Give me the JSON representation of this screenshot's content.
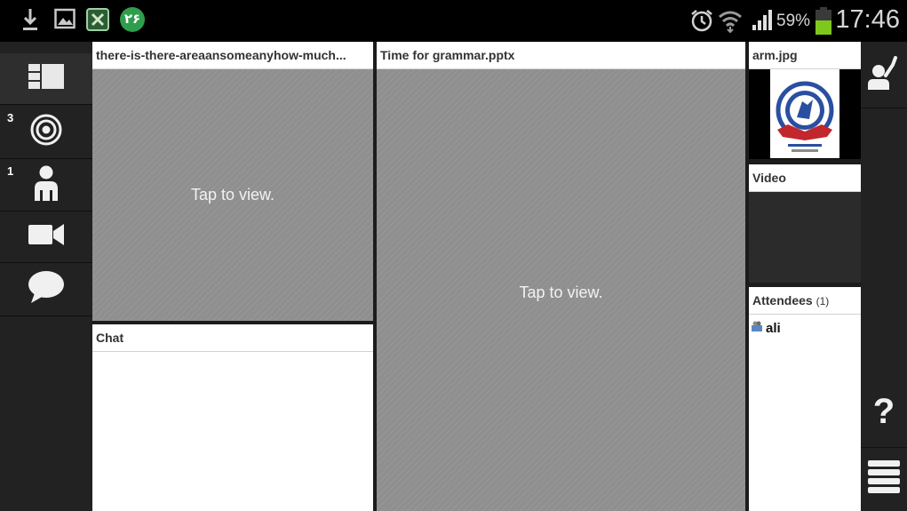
{
  "status_bar": {
    "time": "17:46",
    "battery_percent": "59%",
    "notification_badge": "۲۶",
    "icons": [
      "download-icon",
      "image-icon",
      "app-icon",
      "notification-badge-icon",
      "alarm-icon",
      "wifi-icon",
      "signal-icon",
      "battery-icon"
    ]
  },
  "left_rail": {
    "items": [
      {
        "name": "layout",
        "icon": "layout-icon",
        "badge": ""
      },
      {
        "name": "polls",
        "icon": "target-icon",
        "badge": "3"
      },
      {
        "name": "attendees",
        "icon": "person-icon",
        "badge": "1"
      },
      {
        "name": "video",
        "icon": "video-camera-icon",
        "badge": ""
      },
      {
        "name": "chat",
        "icon": "chat-bubble-icon",
        "badge": ""
      }
    ]
  },
  "panels": {
    "document1": {
      "title": "there-is-there-areaansomeanyhow-much...",
      "tap_text": "Tap to view."
    },
    "chat": {
      "title": "Chat"
    },
    "presentation": {
      "title": "Time for grammar.pptx",
      "tap_text": "Tap to view."
    },
    "image": {
      "title": "arm.jpg"
    },
    "video": {
      "title": "Video"
    },
    "attendees": {
      "title": "Attendees",
      "count": "(1)",
      "list": [
        {
          "name": "ali"
        }
      ]
    }
  },
  "right_rail": {
    "icons": [
      "raise-hand-icon",
      "help-icon",
      "menu-icon"
    ],
    "help_label": "?"
  },
  "colors": {
    "background": "#1c1c1c",
    "rail": "#222222",
    "hatch": "#8f8f8f",
    "badge_green": "#2e9e4c"
  }
}
